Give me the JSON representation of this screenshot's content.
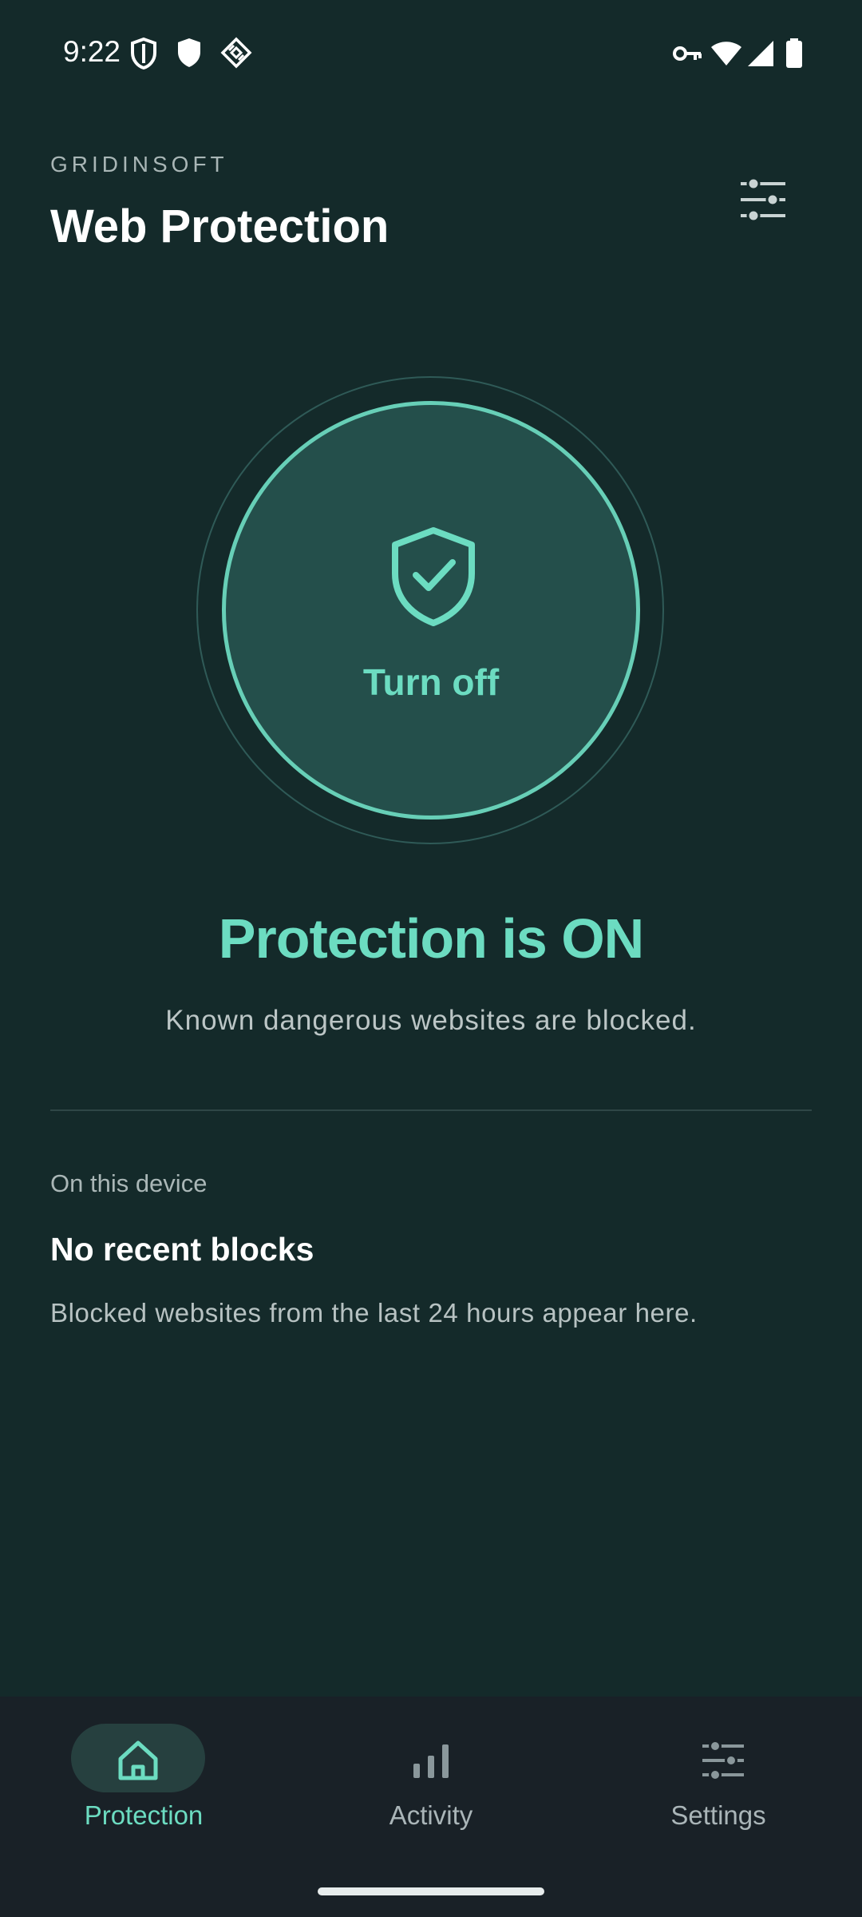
{
  "status_bar": {
    "time": "9:22",
    "left_icons": [
      "shield-outline-icon",
      "shield-icon",
      "diamond-grid-icon"
    ],
    "right_icons": [
      "vpn-key-icon",
      "wifi-icon",
      "signal-icon",
      "battery-icon"
    ]
  },
  "header": {
    "brand": "GRIDINSOFT",
    "title": "Web Protection",
    "filter_icon": "sliders-icon"
  },
  "toggle": {
    "label": "Turn off",
    "icon": "shield-check-icon"
  },
  "status": {
    "title": "Protection is ON",
    "description": "Known dangerous websites are blocked."
  },
  "activity": {
    "section_label": "On this device",
    "empty_title": "No recent blocks",
    "empty_description": "Blocked websites from the last 24 hours appear here."
  },
  "bottom_nav": {
    "items": [
      {
        "label": "Protection",
        "icon": "home-icon",
        "active": true
      },
      {
        "label": "Activity",
        "icon": "bar-chart-icon",
        "active": false
      },
      {
        "label": "Settings",
        "icon": "sliders-icon",
        "active": false
      }
    ]
  },
  "colors": {
    "background": "#142a2a",
    "accent": "#6cdcc1",
    "nav_background": "#192127",
    "circle_fill": "#244f4b"
  }
}
